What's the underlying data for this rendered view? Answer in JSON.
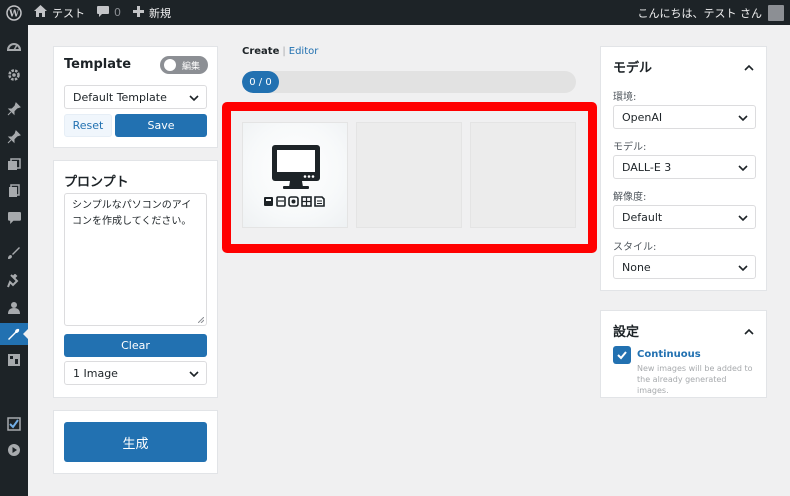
{
  "admin_bar": {
    "site_name": "テスト",
    "comments_count": "0",
    "new_label": "新規",
    "greeting": "こんにちは、テスト さん"
  },
  "sidebar": {
    "items": [
      "dashboard-icon",
      "settings-icon",
      "pin-icon",
      "pin-icon",
      "media-icon",
      "pages-icon",
      "comments-icon",
      "appearance-icon",
      "plugins-icon",
      "users-icon",
      "tools-icon",
      "collapse-icon",
      "checklist-icon",
      "play-icon"
    ],
    "active_index": 10
  },
  "template": {
    "title": "Template",
    "toggle_label": "編集",
    "select_value": "Default Template",
    "reset_label": "Reset",
    "save_label": "Save"
  },
  "prompt": {
    "title": "プロンプト",
    "text": "シンプルなパソコンのアイコンを作成してください。",
    "clear_label": "Clear",
    "count_value": "1 Image"
  },
  "generate": {
    "label": "生成"
  },
  "center": {
    "tab_create": "Create",
    "tab_separator": "|",
    "tab_editor": "Editor",
    "progress_text": "0 / 0",
    "progress_fraction": 0.11,
    "highlight_color": "#ff0000"
  },
  "model_panel": {
    "title": "モデル",
    "env_label": "環境:",
    "env_value": "OpenAI",
    "model_label": "モデル:",
    "model_value": "DALL-E 3",
    "resolution_label": "解像度:",
    "resolution_value": "Default",
    "style_label": "スタイル:",
    "style_value": "None"
  },
  "settings_panel": {
    "title": "設定",
    "continuous_label": "Continuous",
    "continuous_checked": true,
    "continuous_help": "New images will be added to the already generated images."
  },
  "colors": {
    "accent": "#2271b1",
    "admin_dark": "#1d2327",
    "background": "#f0f0f1"
  }
}
